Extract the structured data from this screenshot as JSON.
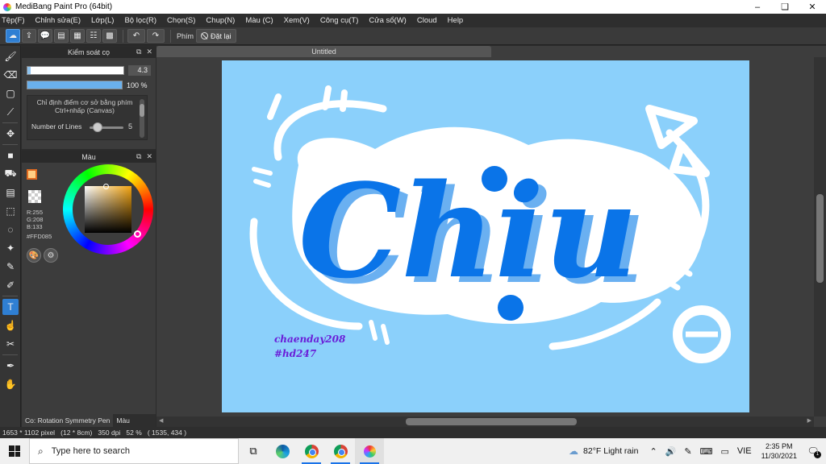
{
  "window": {
    "title": "MediBang Paint Pro (64bit)",
    "minimize": "–",
    "maximize": "❏",
    "close": "✕"
  },
  "menu": [
    "Tệp(F)",
    "Chỉnh sửa(E)",
    "Lớp(L)",
    "Bộ lọc(R)",
    "Chọn(S)",
    "Chup(N)",
    "Màu (C)",
    "Xem(V)",
    "Công cụ(T)",
    "Cửa sổ(W)",
    "Cloud",
    "Help"
  ],
  "toolbar": {
    "keys_label": "Phím",
    "reset_label": "Đặt lại"
  },
  "brush_panel": {
    "title": "Kiểm soát cọ",
    "size_value": "4.3",
    "size_fraction": 0.03,
    "opacity_value": "100 %",
    "hint_text": "Chỉ định điểm cơ sở bằng phím Ctrl+nhấp (Canvas)",
    "lines_label": "Number of Lines",
    "lines_value": "5"
  },
  "color_panel": {
    "title": "Màu",
    "r": "R:255",
    "g": "G:208",
    "b": "B:133",
    "hex": "#FFD085",
    "fg_color": "#ffd085"
  },
  "bottom_tabs": {
    "brush_tab": "Co: Rotation Symmetry Pen",
    "color_tab": "Màu"
  },
  "document": {
    "tab_title": "Untitled",
    "canvas_bg": "#8bd0fb",
    "artwork_text": "Chiu",
    "signature_line1": "chaenday208",
    "signature_line2": "#hd247"
  },
  "status": {
    "text": "1653 * 1102 pixel   (12 * 8cm)   350 dpi   52 %   ( 1535, 434 )"
  },
  "taskbar": {
    "search_placeholder": "Type here to search",
    "weather": "82°F  Light rain",
    "lang": "VIE",
    "time": "2:35 PM",
    "date": "11/30/2021",
    "notif_count": "1"
  }
}
